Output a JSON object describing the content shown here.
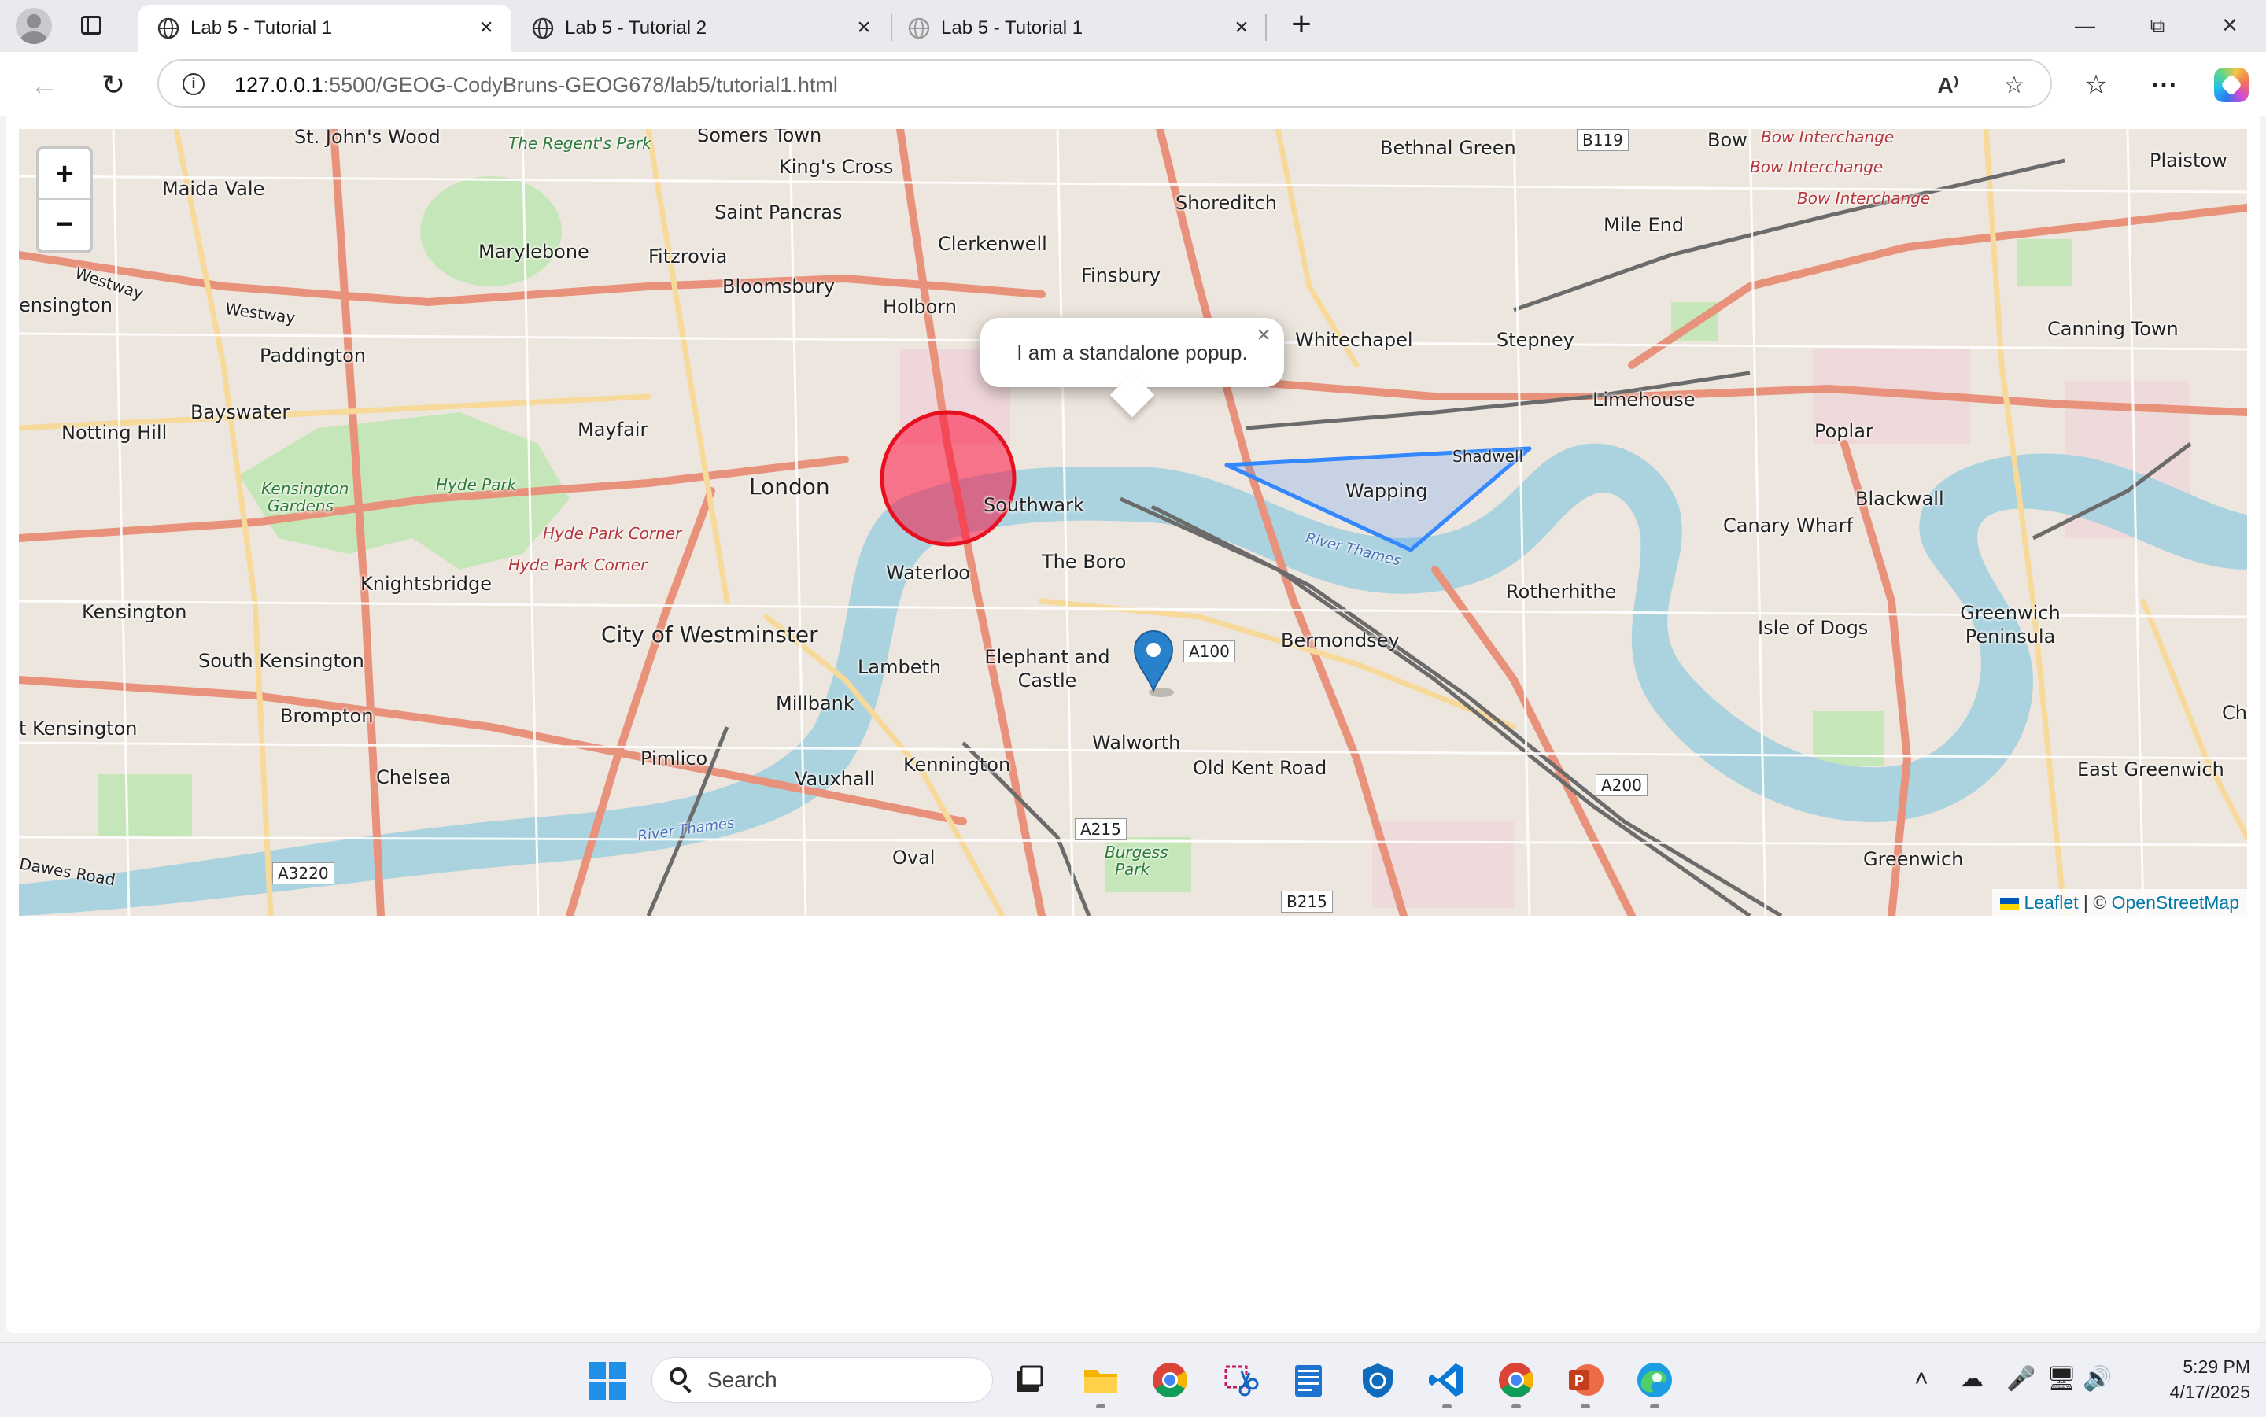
{
  "tabs": [
    {
      "title": "Lab 5 - Tutorial 1",
      "active": true
    },
    {
      "title": "Lab 5 - Tutorial 2",
      "active": false
    },
    {
      "title": "Lab 5 - Tutorial 1",
      "active": false
    }
  ],
  "address": {
    "host": "127.0.0.1",
    "rest": ":5500/GEOG-CodyBruns-GEOG678/lab5/tutorial1.html"
  },
  "map": {
    "zoom_in": "+",
    "zoom_out": "−",
    "popup_text": "I am a standalone popup.",
    "popup_close": "×",
    "attribution": {
      "leaflet": "Leaflet",
      "separator": " | © ",
      "osm": "OpenStreetMap"
    },
    "circle": {
      "stroke": "#e8101f",
      "fill": "#f03"
    },
    "polygon": {
      "stroke": "#3388ff"
    },
    "labels": {
      "st_johns_wood": "St. John's Wood",
      "regents_park": "The Regent's Park",
      "somers_town": "Somers Town",
      "kings_cross": "King's Cross",
      "bethnal_green": "Bethnal Green",
      "b119": "B119",
      "bow": "Bow",
      "bow_interchange_1": "Bow Interchange",
      "bow_interchange_2": "Bow Interchange",
      "bow_interchange_3": "Bow Interchange",
      "plaistow": "Plaistow",
      "maida_vale": "Maida Vale",
      "saint_pancras": "Saint Pancras",
      "shoreditch": "Shoreditch",
      "mile_end": "Mile End",
      "marylebone": "Marylebone",
      "fitzrovia": "Fitzrovia",
      "clerkenwell": "Clerkenwell",
      "westway_1": "Westway",
      "westway_2": "Westway",
      "finsbury": "Finsbury",
      "bloomsbury": "Bloomsbury",
      "kensington_w": "ensington",
      "holborn": "Holborn",
      "whitechapel": "Whitechapel",
      "stepney": "Stepney",
      "canning_town": "Canning Town",
      "paddington": "Paddington",
      "limehouse": "Limehouse",
      "bayswater": "Bayswater",
      "notting_hill": "Notting Hill",
      "mayfair": "Mayfair",
      "poplar": "Poplar",
      "shadwell": "Shadwell",
      "kensington_gardens": "Kensington Gardens",
      "hyde_park": "Hyde Park",
      "london": "London",
      "wapping": "Wapping",
      "southwark": "Southwark",
      "blackwall": "Blackwall",
      "canary_wharf": "Canary Wharf",
      "hyde_park_corner_1": "Hyde Park Corner",
      "hyde_park_corner_2": "Hyde Park Corner",
      "the_borough": "The Boro",
      "waterloo": "Waterloo",
      "river_thames_1": "River Thames",
      "knightsbridge": "Knightsbridge",
      "rotherhithe": "Rotherhithe",
      "kensington": "Kensington",
      "isle_of_dogs": "Isle of Dogs",
      "greenwich_peninsula": "Greenwich Peninsula",
      "city_of_westminster": "City of Westminster",
      "bermondsey": "Bermondsey",
      "a100": "A100",
      "elephant_and_castle": "Elephant and Castle",
      "south_kensington": "South Kensington",
      "lambeth": "Lambeth",
      "millbank": "Millbank",
      "brompton": "Brompton",
      "west_kensington": "t Kensington",
      "walworth": "Walworth",
      "old_kent_road": "Old Kent Road",
      "kennington": "Kennington",
      "ch": "Ch",
      "east_greenwich": "East Greenwich",
      "chelsea": "Chelsea",
      "pimlico": "Pimlico",
      "vauxhall": "Vauxhall",
      "a200": "A200",
      "river_thames_2": "River Thames",
      "a215": "A215",
      "dawes_road": "Dawes Road",
      "a3220": "A3220",
      "oval": "Oval",
      "burgess_park": "Burgess Park",
      "greenwich": "Greenwich",
      "b215": "B215"
    }
  },
  "taskbar": {
    "search_placeholder": "Search",
    "time": "5:29 PM",
    "date": "4/17/2025"
  }
}
